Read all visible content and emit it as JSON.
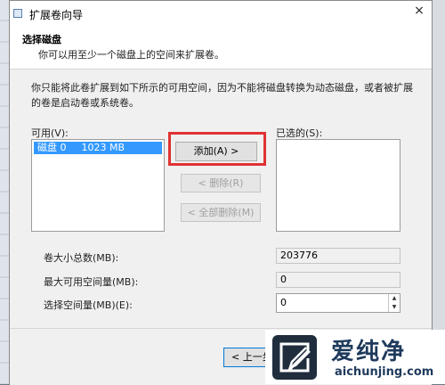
{
  "window": {
    "title": "扩展卷向导",
    "close_glyph": "×"
  },
  "header": {
    "title": "选择磁盘",
    "subtitle": "你可以用至少一个磁盘上的空间来扩展卷。"
  },
  "description": "你只能将此卷扩展到如下所示的可用空间，因为不能将磁盘转换为动态磁盘，或者被扩展的卷是启动卷或系统卷。",
  "available": {
    "label": "可用(V):",
    "items": [
      {
        "name": "磁盘 0",
        "size": "1023 MB",
        "selected": true
      }
    ]
  },
  "selected": {
    "label": "已选的(S):"
  },
  "buttons": {
    "add": "添加(A) >",
    "remove": "< 删除(R)",
    "remove_all": "< 全部删除(M)",
    "back": "< 上一步"
  },
  "fields": {
    "total_size_label": "卷大小总数(MB):",
    "total_size_value": "203776",
    "max_space_label": "最大可用空间量(MB):",
    "max_space_value": "0",
    "select_space_label": "选择空间量(MB)(E):",
    "select_space_value": "0"
  },
  "watermark": {
    "brand": "爱纯净",
    "url": "aichunjing.com"
  },
  "colors": {
    "selection": "#3399ff",
    "highlight": "#e03232",
    "watermark_text": "#1e3a5c"
  }
}
